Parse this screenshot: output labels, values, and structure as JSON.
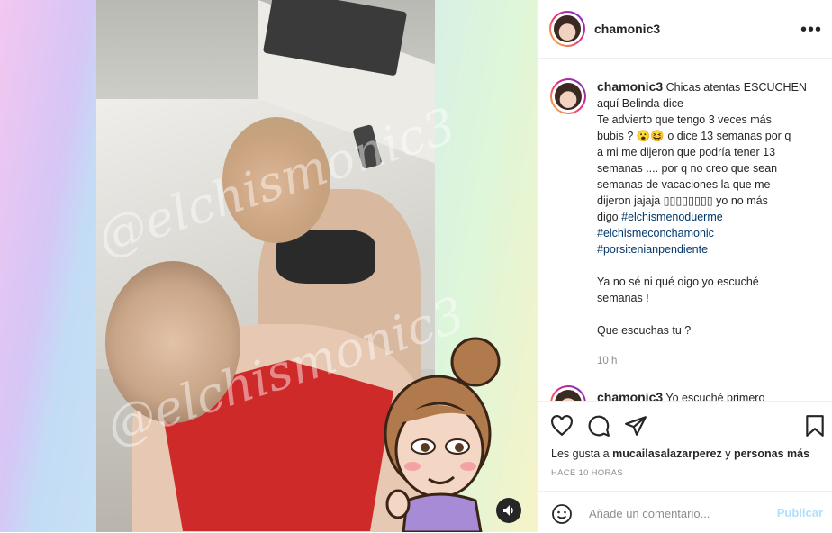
{
  "post": {
    "username": "chamonic3",
    "watermark": "@elchismonic3",
    "caption_lines": [
      "Chicas atentas ESCUCHEN",
      "aquí Belinda dice",
      "Te advierto que tengo 3 veces más",
      "bubis ? 😮😆 o dice 13 semanas por q",
      "a mi me dijeron que podría tener 13",
      "semanas .... por q no creo que sean",
      "semanas de vacaciones la que me",
      "dijeron jajaja ▯▯▯▯▯▯▯▯ yo no más",
      "digo"
    ],
    "hashtags": [
      "#elchismenoduerme",
      "#elchismeconchamonic",
      "#porsitenianpendiente"
    ],
    "paragraph2": [
      "Ya no sé ni qué oigo yo escuché",
      "semanas !"
    ],
    "paragraph3": "Que escuchas tu ?",
    "time": "10 h",
    "reply": {
      "username": "chamonic3",
      "text": "Yo escuché primero"
    },
    "likes": {
      "prefix": "Les gusta a",
      "user": "mucailasalazarperez",
      "conj": "y",
      "others": "personas más"
    },
    "ago": "HACE 10 HORAS"
  },
  "input": {
    "placeholder": "Añade un comentario...",
    "post_label": "Publicar"
  },
  "icons": {
    "more": "more-icon",
    "heart": "heart-icon",
    "comment": "comment-icon",
    "share": "share-icon",
    "bookmark": "bookmark-icon",
    "emoji": "emoji-icon",
    "mute": "speaker-icon"
  },
  "colors": {
    "link": "#00376b",
    "muted": "#8e8e8e",
    "post_disabled": "#b2dffc"
  }
}
